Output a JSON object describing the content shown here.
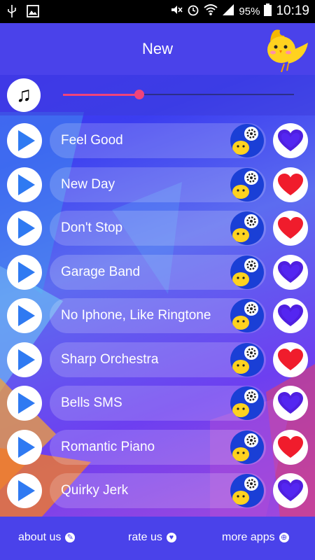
{
  "status_bar": {
    "battery": "95%",
    "time": "10:19"
  },
  "header": {
    "title": "New"
  },
  "player": {
    "progress": 0.33,
    "accent_color": "#f0447a"
  },
  "songs": [
    {
      "title": "Feel Good",
      "favorite": false
    },
    {
      "title": "New Day",
      "favorite": true
    },
    {
      "title": "Don't Stop",
      "favorite": true
    },
    {
      "title": "Garage Band",
      "favorite": false
    },
    {
      "title": "No Iphone, Like Ringtone",
      "favorite": false
    },
    {
      "title": "Sharp Orchestra",
      "favorite": true
    },
    {
      "title": "Bells SMS",
      "favorite": false
    },
    {
      "title": "Romantic Piano",
      "favorite": true
    },
    {
      "title": "Quirky Jerk",
      "favorite": false
    }
  ],
  "footer": {
    "about": "about us",
    "rate": "rate us",
    "more": "more apps"
  },
  "colors": {
    "heart_on": "#f01c2c",
    "heart_off": "#4f1fe0",
    "bar": "#4a42ea"
  }
}
